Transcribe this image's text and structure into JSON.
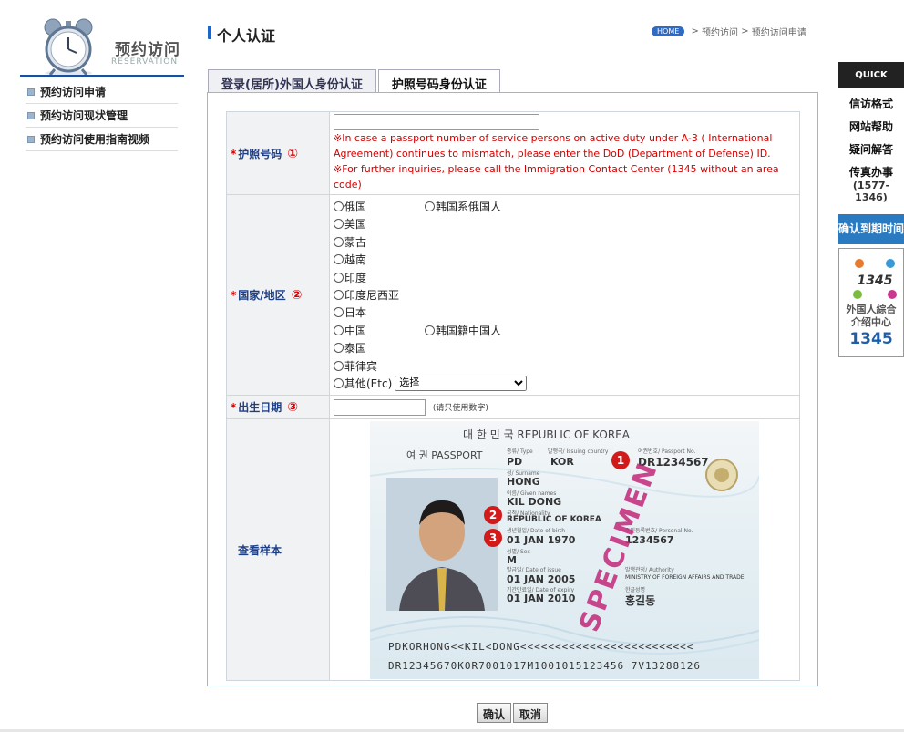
{
  "logo": {
    "title": "预约访问",
    "subtitle": "RESERVATION"
  },
  "sidebar": {
    "items": [
      {
        "label": "预约访问申请"
      },
      {
        "label": "预约访问现状管理"
      },
      {
        "label": "预约访问使用指南视频"
      }
    ]
  },
  "header": {
    "title": "个人认证"
  },
  "breadcrumb": {
    "home": "HOME",
    "level1": "预约访问",
    "level2": "预约访问申请"
  },
  "tabs": [
    {
      "label": "登录(居所)外国人身份认证",
      "active": false
    },
    {
      "label": "护照号码身份认证",
      "active": true
    }
  ],
  "form": {
    "passport": {
      "label": "护照号码",
      "number": "①",
      "value": "",
      "warning1": "※In case a passport number of service persons on active duty under A-3 ( International Agreement) continues to mismatch, please enter the DoD (Department of Defense) ID.",
      "warning2": "※For further inquiries, please call the Immigration Contact Center (1345 without an area code)"
    },
    "country": {
      "label": "国家/地区",
      "number": "②",
      "options": [
        "俄国",
        "韩国系俄国人",
        "美国",
        "蒙古",
        "越南",
        "印度",
        "印度尼西亚",
        "日本",
        "中国",
        "韩国籍中国人",
        "泰国",
        "菲律宾",
        "其他(Etc)"
      ],
      "select_value": "选择"
    },
    "birthdate": {
      "label": "出生日期",
      "number": "③",
      "value": "",
      "hint": "(请只使用数字)"
    },
    "sample": {
      "label": "查看样本"
    }
  },
  "passport_sample": {
    "header": "대 한 민 국   REPUBLIC OF KOREA",
    "doc": "여 권  PASSPORT",
    "type_label": "종류/ Type",
    "type": "PD",
    "issuing_label": "발행국/ Issuing country",
    "issuing": "KOR",
    "passport_no_label": "여권번호/ Passport No.",
    "passport_no": "DR1234567",
    "surname_label": "성/ Surname",
    "surname": "HONG",
    "given_label": "이름/ Given names",
    "given": "KIL DONG",
    "nationality_label": "국적/ Nationality",
    "nationality": "REPUBLIC OF KOREA",
    "dob_label": "생년월일/ Date of birth",
    "dob": "01 JAN 1970",
    "personal_label": "주민등록번호/ Personal No.",
    "personal": "1234567",
    "sex_label": "성별/ Sex",
    "sex": "M",
    "issue_label": "발급일/ Date of issue",
    "issue": "01 JAN 2005",
    "authority_label": "발행관청/ Authority",
    "authority": "MINISTRY OF FOREIGN AFFAIRS AND TRADE",
    "expiry_label": "기간만료일/ Date of expiry",
    "expiry": "01 JAN 2010",
    "signature_label": "한글성명",
    "signature": "홍길동",
    "specimen": "SPECIMEN",
    "mrz1": "PDKORHONG<<KIL<DONG<<<<<<<<<<<<<<<<<<<<<<<<<",
    "mrz2": "DR12345670KOR7001017M1001015123456 7V13288126",
    "badge1": "1",
    "badge2": "2",
    "badge3": "3"
  },
  "buttons": {
    "confirm": "确认",
    "cancel": "取消"
  },
  "quick": {
    "head": "QUICK",
    "items": [
      "信访格式",
      "网站帮助",
      "疑问解答",
      "传真办事"
    ],
    "phone": "(1577-1346)",
    "blue": "确认到期时间",
    "box_line1": "外国人綜合",
    "box_line2": "介绍中心",
    "box_num": "1345",
    "logo_num": "1345"
  }
}
